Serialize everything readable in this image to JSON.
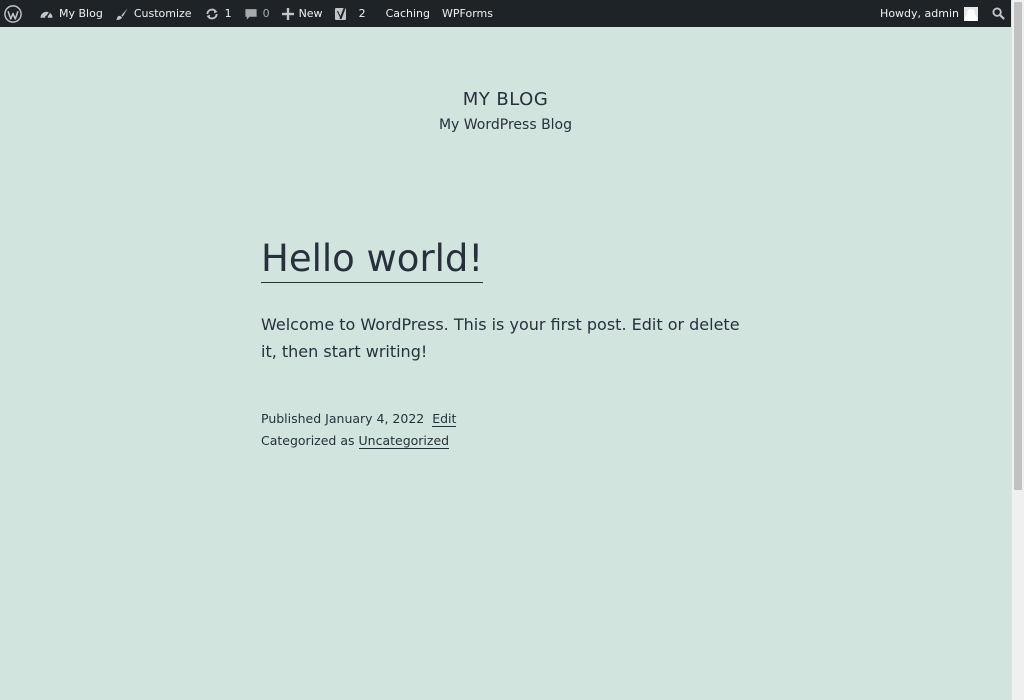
{
  "adminbar": {
    "site_name": "My Blog",
    "customize": "Customize",
    "updates_count": "1",
    "comments_count": "0",
    "new_label": "New",
    "yoast_count": "2",
    "caching": "Caching",
    "wpforms": "WPForms",
    "howdy": "Howdy, admin"
  },
  "site": {
    "title": "MY BLOG",
    "description": "My WordPress Blog"
  },
  "post": {
    "title": "Hello world!",
    "content": "Welcome to WordPress. This is your first post. Edit or delete it, then start writing!",
    "published_label": "Published",
    "published_date": "January 4, 2022",
    "edit_label": "Edit",
    "categorized_label": "Categorized as",
    "category": "Uncategorized"
  },
  "colors": {
    "background": "#d1e4dd",
    "adminbar_bg": "#1d2327",
    "text": "#28303d"
  }
}
